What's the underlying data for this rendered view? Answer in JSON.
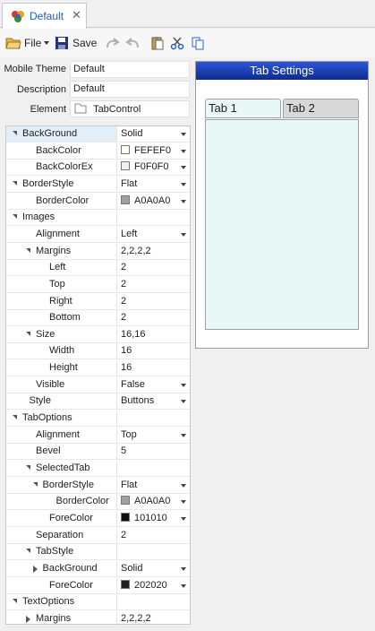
{
  "doc_tab": {
    "title": "Default",
    "close": "✕"
  },
  "toolbar": {
    "file_label": "File",
    "save_label": "Save"
  },
  "form": {
    "theme_label": "Mobile Theme",
    "theme_value": "Default",
    "desc_label": "Description",
    "desc_value": "Default",
    "element_label": "Element",
    "element_value": "TabControl"
  },
  "properties": [
    {
      "name": "BackGround",
      "indent": 0,
      "expander": "open",
      "value": "Solid",
      "dropdown": true,
      "selected": true
    },
    {
      "name": "BackColor",
      "indent": 2,
      "value": "FEFEF0",
      "swatch": "#fefef0",
      "dropdown": true
    },
    {
      "name": "BackColorEx",
      "indent": 2,
      "value": "F0F0F0",
      "swatch": "#f0f0f0",
      "dropdown": true
    },
    {
      "name": "BorderStyle",
      "indent": 0,
      "expander": "open",
      "value": "Flat",
      "dropdown": true
    },
    {
      "name": "BorderColor",
      "indent": 2,
      "value": "A0A0A0",
      "swatch": "#a0a0a0",
      "dropdown": true
    },
    {
      "name": "Images",
      "indent": 0,
      "expander": "open",
      "value": ""
    },
    {
      "name": "Alignment",
      "indent": 2,
      "value": "Left",
      "dropdown": true
    },
    {
      "name": "Margins",
      "indent": 2,
      "expander": "open",
      "value": "2,2,2,2"
    },
    {
      "name": "Left",
      "indent": 4,
      "value": "2"
    },
    {
      "name": "Top",
      "indent": 4,
      "value": "2"
    },
    {
      "name": "Right",
      "indent": 4,
      "value": "2"
    },
    {
      "name": "Bottom",
      "indent": 4,
      "value": "2"
    },
    {
      "name": "Size",
      "indent": 2,
      "expander": "open",
      "value": "16,16"
    },
    {
      "name": "Width",
      "indent": 4,
      "value": "16"
    },
    {
      "name": "Height",
      "indent": 4,
      "value": "16"
    },
    {
      "name": "Visible",
      "indent": 2,
      "value": "False",
      "dropdown": true
    },
    {
      "name": "Style",
      "indent": 1,
      "value": "Buttons",
      "dropdown": true
    },
    {
      "name": "TabOptions",
      "indent": 0,
      "expander": "open",
      "value": ""
    },
    {
      "name": "Alignment",
      "indent": 2,
      "value": "Top",
      "dropdown": true
    },
    {
      "name": "Bevel",
      "indent": 2,
      "value": "5"
    },
    {
      "name": "SelectedTab",
      "indent": 2,
      "expander": "open",
      "value": ""
    },
    {
      "name": "BorderStyle",
      "indent": 3,
      "expander": "open",
      "value": "Flat",
      "dropdown": true
    },
    {
      "name": "BorderColor",
      "indent": 5,
      "value": "A0A0A0",
      "swatch": "#a0a0a0",
      "dropdown": true
    },
    {
      "name": "ForeColor",
      "indent": 4,
      "value": "101010",
      "swatch": "#101010",
      "dropdown": true
    },
    {
      "name": "Separation",
      "indent": 2,
      "value": "2"
    },
    {
      "name": "TabStyle",
      "indent": 2,
      "expander": "open",
      "value": ""
    },
    {
      "name": "BackGround",
      "indent": 3,
      "expander": "closed",
      "value": "Solid",
      "dropdown": true
    },
    {
      "name": "ForeColor",
      "indent": 4,
      "value": "202020",
      "swatch": "#202020",
      "dropdown": true
    },
    {
      "name": "TextOptions",
      "indent": 0,
      "expander": "open",
      "value": ""
    },
    {
      "name": "Margins",
      "indent": 2,
      "expander": "closed",
      "value": "2,2,2,2"
    }
  ],
  "preview": {
    "header": "Tab Settings",
    "tabs": [
      "Tab 1",
      "Tab 2"
    ],
    "header_color": "#1e3fb0",
    "selected_tab_color": "#e8f8f6",
    "tab_color": "#d8d8d8"
  }
}
